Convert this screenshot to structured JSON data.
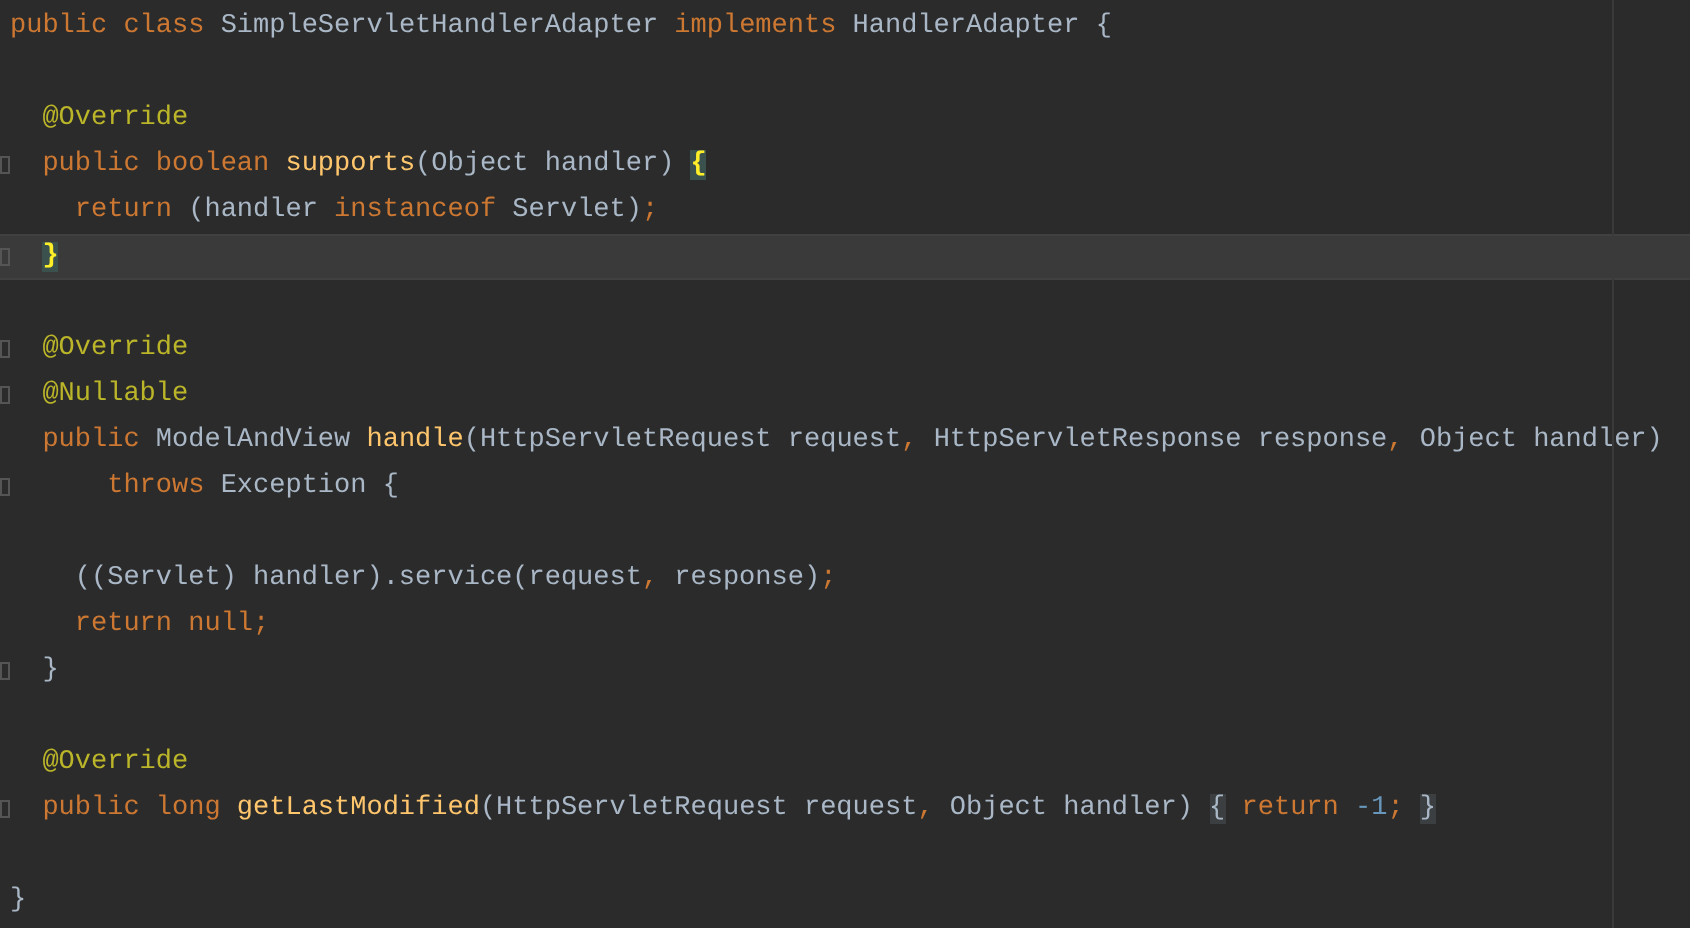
{
  "editor": {
    "lines": [
      {
        "current": false,
        "fold_marker": false,
        "tokens": [
          {
            "kind": "keyword",
            "text": "public class "
          },
          {
            "kind": "plain",
            "text": "SimpleServletHandlerAdapter "
          },
          {
            "kind": "keyword",
            "text": "implements "
          },
          {
            "kind": "plain",
            "text": "HandlerAdapter {"
          }
        ]
      },
      {
        "current": false,
        "fold_marker": false
      },
      {
        "current": false,
        "fold_marker": false,
        "tokens": [
          {
            "kind": "annotation",
            "text": "  @Override"
          }
        ]
      },
      {
        "current": false,
        "fold_marker": true,
        "tokens": [
          {
            "kind": "keyword",
            "text": "  public boolean "
          },
          {
            "kind": "method",
            "text": "supports"
          },
          {
            "kind": "plain",
            "text": "(Object handler) "
          },
          {
            "kind": "brace_match",
            "text": "{"
          }
        ]
      },
      {
        "current": false,
        "fold_marker": false,
        "tokens": [
          {
            "kind": "keyword",
            "text": "    return "
          },
          {
            "kind": "plain",
            "text": "(handler "
          },
          {
            "kind": "keyword",
            "text": "instanceof "
          },
          {
            "kind": "plain",
            "text": "Servlet)"
          },
          {
            "kind": "keyword",
            "text": ";"
          }
        ]
      },
      {
        "current": true,
        "fold_marker": true,
        "tokens": [
          {
            "kind": "brace_match",
            "text": "  }"
          }
        ]
      },
      {
        "current": false,
        "fold_marker": false
      },
      {
        "current": false,
        "fold_marker": true,
        "tokens": [
          {
            "kind": "annotation",
            "text": "  @Override"
          }
        ]
      },
      {
        "current": false,
        "fold_marker": true,
        "tokens": [
          {
            "kind": "annotation",
            "text": "  @Nullable"
          }
        ]
      },
      {
        "current": false,
        "fold_marker": false,
        "tokens": [
          {
            "kind": "keyword",
            "text": "  public "
          },
          {
            "kind": "plain",
            "text": "ModelAndView "
          },
          {
            "kind": "method",
            "text": "handle"
          },
          {
            "kind": "plain",
            "text": "(HttpServletRequest request"
          },
          {
            "kind": "keyword",
            "text": ", "
          },
          {
            "kind": "plain",
            "text": "HttpServletResponse response"
          },
          {
            "kind": "keyword",
            "text": ", "
          },
          {
            "kind": "plain",
            "text": "Object handler)"
          }
        ]
      },
      {
        "current": false,
        "fold_marker": true,
        "tokens": [
          {
            "kind": "keyword",
            "text": "      throws "
          },
          {
            "kind": "plain",
            "text": "Exception {"
          }
        ]
      },
      {
        "current": false,
        "fold_marker": false
      },
      {
        "current": false,
        "fold_marker": false,
        "tokens": [
          {
            "kind": "plain",
            "text": "    ((Servlet) handler).service(request"
          },
          {
            "kind": "keyword",
            "text": ", "
          },
          {
            "kind": "plain",
            "text": "response)"
          },
          {
            "kind": "keyword",
            "text": ";"
          }
        ]
      },
      {
        "current": false,
        "fold_marker": false,
        "tokens": [
          {
            "kind": "keyword",
            "text": "    return null;"
          }
        ]
      },
      {
        "current": false,
        "fold_marker": true,
        "tokens": [
          {
            "kind": "plain",
            "text": "  }"
          }
        ]
      },
      {
        "current": false,
        "fold_marker": false
      },
      {
        "current": false,
        "fold_marker": false,
        "tokens": [
          {
            "kind": "annotation",
            "text": "  @Override"
          }
        ]
      },
      {
        "current": false,
        "fold_marker": true,
        "tokens": [
          {
            "kind": "keyword",
            "text": "  public long "
          },
          {
            "kind": "method",
            "text": "getLastModified"
          },
          {
            "kind": "plain",
            "text": "(HttpServletRequest request"
          },
          {
            "kind": "keyword",
            "text": ", "
          },
          {
            "kind": "plain",
            "text": "Object handler)"
          },
          {
            "kind": "folded",
            "text": " {"
          },
          {
            "kind": "keyword",
            "text": " return "
          },
          {
            "kind": "number",
            "text": "-1"
          },
          {
            "kind": "keyword",
            "text": ";"
          },
          {
            "kind": "folded",
            "text": " }"
          }
        ]
      },
      {
        "current": false,
        "fold_marker": false
      },
      {
        "current": false,
        "fold_marker": false,
        "tokens": [
          {
            "kind": "plain",
            "text": "}"
          }
        ]
      }
    ]
  }
}
